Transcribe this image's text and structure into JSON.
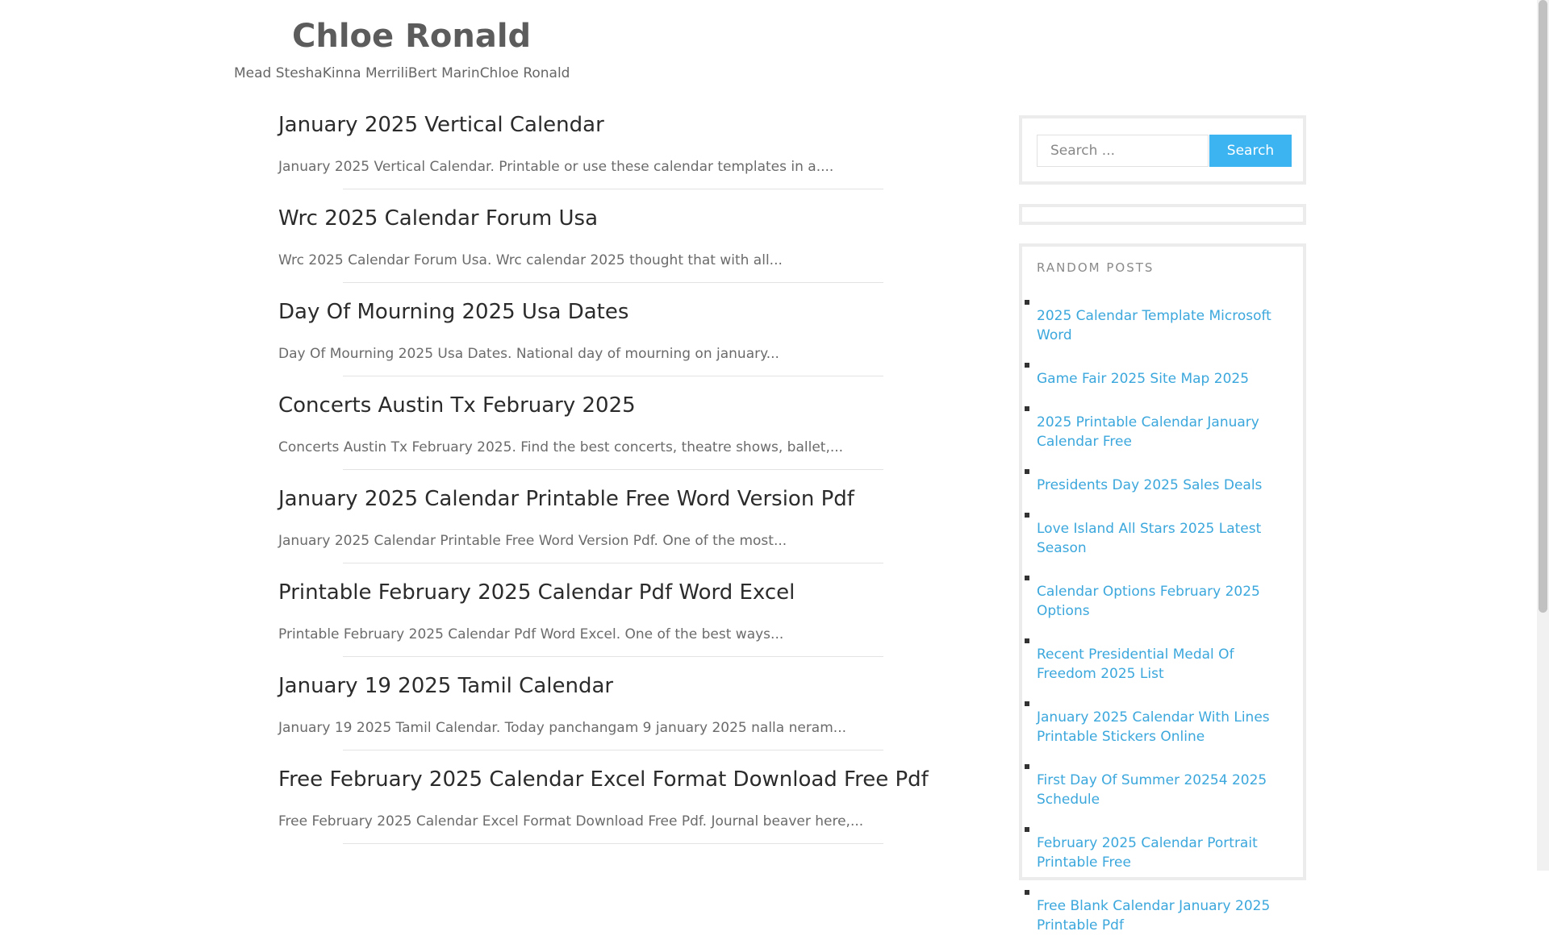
{
  "site": {
    "title": "Chloe Ronald",
    "nav": [
      "Mead Stesha",
      "Kinna Merrili",
      "Bert Marin",
      "Chloe Ronald"
    ]
  },
  "posts": [
    {
      "title": "January 2025 Vertical Calendar",
      "excerpt": "January 2025 Vertical Calendar. Printable or use these calendar templates in a...."
    },
    {
      "title": "Wrc 2025 Calendar Forum Usa",
      "excerpt": "Wrc 2025 Calendar Forum Usa. Wrc calendar 2025 thought that with all..."
    },
    {
      "title": "Day Of Mourning 2025 Usa Dates",
      "excerpt": "Day Of Mourning 2025 Usa Dates. National day of mourning on january..."
    },
    {
      "title": "Concerts Austin Tx February 2025",
      "excerpt": "Concerts Austin Tx February 2025. Find the best concerts, theatre shows, ballet,..."
    },
    {
      "title": "January 2025 Calendar Printable Free Word Version Pdf",
      "excerpt": "January 2025 Calendar Printable Free Word Version Pdf. One of the most..."
    },
    {
      "title": "Printable February 2025 Calendar Pdf Word Excel",
      "excerpt": "Printable February 2025 Calendar Pdf Word Excel. One of the best ways..."
    },
    {
      "title": "January 19 2025 Tamil Calendar",
      "excerpt": "January 19 2025 Tamil Calendar. Today panchangam 9 january 2025 nalla neram..."
    },
    {
      "title": "Free February 2025 Calendar Excel Format Download Free Pdf",
      "excerpt": "Free February 2025 Calendar Excel Format Download Free Pdf. Journal beaver here,..."
    }
  ],
  "search": {
    "placeholder": "Search ...",
    "button_label": "Search"
  },
  "random_posts": {
    "title": "RANDOM POSTS",
    "items": [
      "2025 Calendar Template Microsoft Word",
      "Game Fair 2025 Site Map 2025",
      "2025 Printable Calendar January Calendar Free",
      "Presidents Day 2025 Sales Deals",
      "Love Island All Stars 2025 Latest Season",
      "Calendar Options February 2025 Options",
      "Recent Presidential Medal Of Freedom 2025 List",
      "January 2025 Calendar With Lines Printable Stickers Online",
      "First Day Of Summer 20254 2025 Schedule",
      "February 2025 Calendar Portrait Printable Free",
      "Free Blank Calendar January 2025 Printable Pdf"
    ]
  },
  "colors": {
    "link": "#3ba7dc",
    "search_button": "#3cb4f1"
  }
}
